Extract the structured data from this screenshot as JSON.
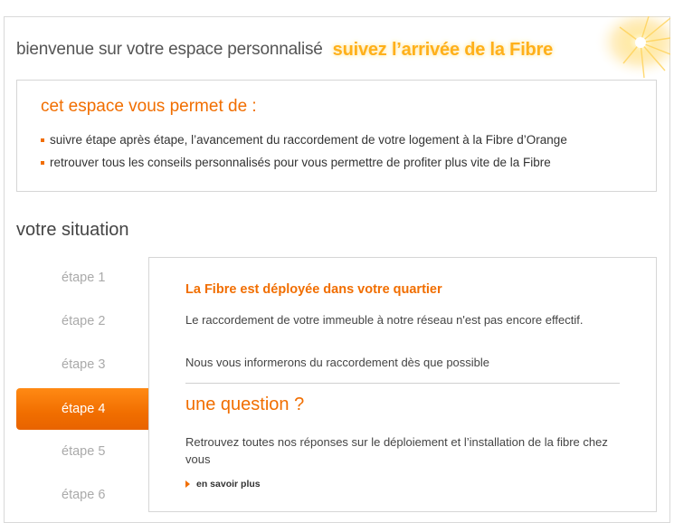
{
  "header": {
    "welcome": "bienvenue sur votre espace personnalisé",
    "slogan": "suivez l’arrivée de la Fibre"
  },
  "intro": {
    "title": "cet espace vous permet de :",
    "items": [
      "suivre étape après étape, l’avancement du raccordement de votre logement à la Fibre d’Orange",
      "retrouver tous les conseils personnalisés pour vous permettre de profiter plus vite de la Fibre"
    ]
  },
  "situation": {
    "title": "votre situation"
  },
  "steps": [
    "étape 1",
    "étape 2",
    "étape 3",
    "étape 4",
    "étape 5",
    "étape 6"
  ],
  "active_step": 4,
  "status": {
    "title": "La Fibre est déployée dans votre quartier",
    "text": "Le raccordement de votre immeuble à notre réseau n'est pas encore effectif.",
    "info": "Nous vous informerons du raccordement dès que possible"
  },
  "question": {
    "title": "une question ?",
    "text": "Retrouvez toutes nos réponses sur le déploiement et l’installation de la fibre chez vous",
    "link_label": "en savoir plus"
  },
  "colors": {
    "accent": "#f16e00",
    "slogan": "#ffb01a",
    "inactive_step": "#aaaaaa"
  },
  "icons": {
    "sparkle": "sparkle-icon",
    "bullet": "square-bullet-icon",
    "link_arrow": "arrow-right-icon"
  }
}
